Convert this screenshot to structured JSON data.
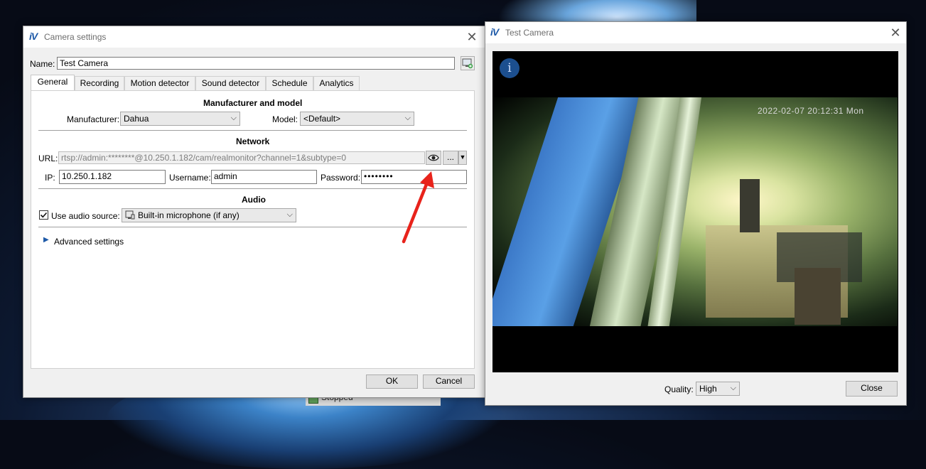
{
  "background": {
    "taskbar_fragment": "Stopped"
  },
  "settings_window": {
    "title": "Camera settings",
    "logo": "iV",
    "name_label": "Name:",
    "name_value": "Test Camera",
    "tabs": [
      {
        "label": "General",
        "active": true
      },
      {
        "label": "Recording",
        "active": false
      },
      {
        "label": "Motion detector",
        "active": false
      },
      {
        "label": "Sound detector",
        "active": false
      },
      {
        "label": "Schedule",
        "active": false
      },
      {
        "label": "Analytics",
        "active": false
      }
    ],
    "manufacturer_section": {
      "title": "Manufacturer and model",
      "manufacturer_label": "Manufacturer:",
      "manufacturer_value": "Dahua",
      "model_label": "Model:",
      "model_value": "<Default>"
    },
    "network_section": {
      "title": "Network",
      "url_label": "URL:",
      "url_value": "rtsp://admin:********@10.250.1.182/cam/realmonitor?channel=1&subtype=0",
      "more_label": "...",
      "ip_label": "IP:",
      "ip_value": "10.250.1.182",
      "username_label": "Username:",
      "username_value": "admin",
      "password_label": "Password:",
      "password_value": "••••••••"
    },
    "audio_section": {
      "title": "Audio",
      "use_audio_label": "Use audio source:",
      "use_audio_checked": true,
      "audio_source_value": "Built-in microphone (if any)"
    },
    "advanced_label": "Advanced settings",
    "ok_label": "OK",
    "cancel_label": "Cancel"
  },
  "test_window": {
    "title": "Test Camera",
    "logo": "iV",
    "info_icon": "i",
    "osd_timestamp": "2022-02-07 20:12:31 Mon",
    "quality_label": "Quality:",
    "quality_value": "High",
    "close_label": "Close"
  },
  "colors": {
    "annotation_arrow": "#e8231b",
    "accent": "#1e5aa8"
  }
}
